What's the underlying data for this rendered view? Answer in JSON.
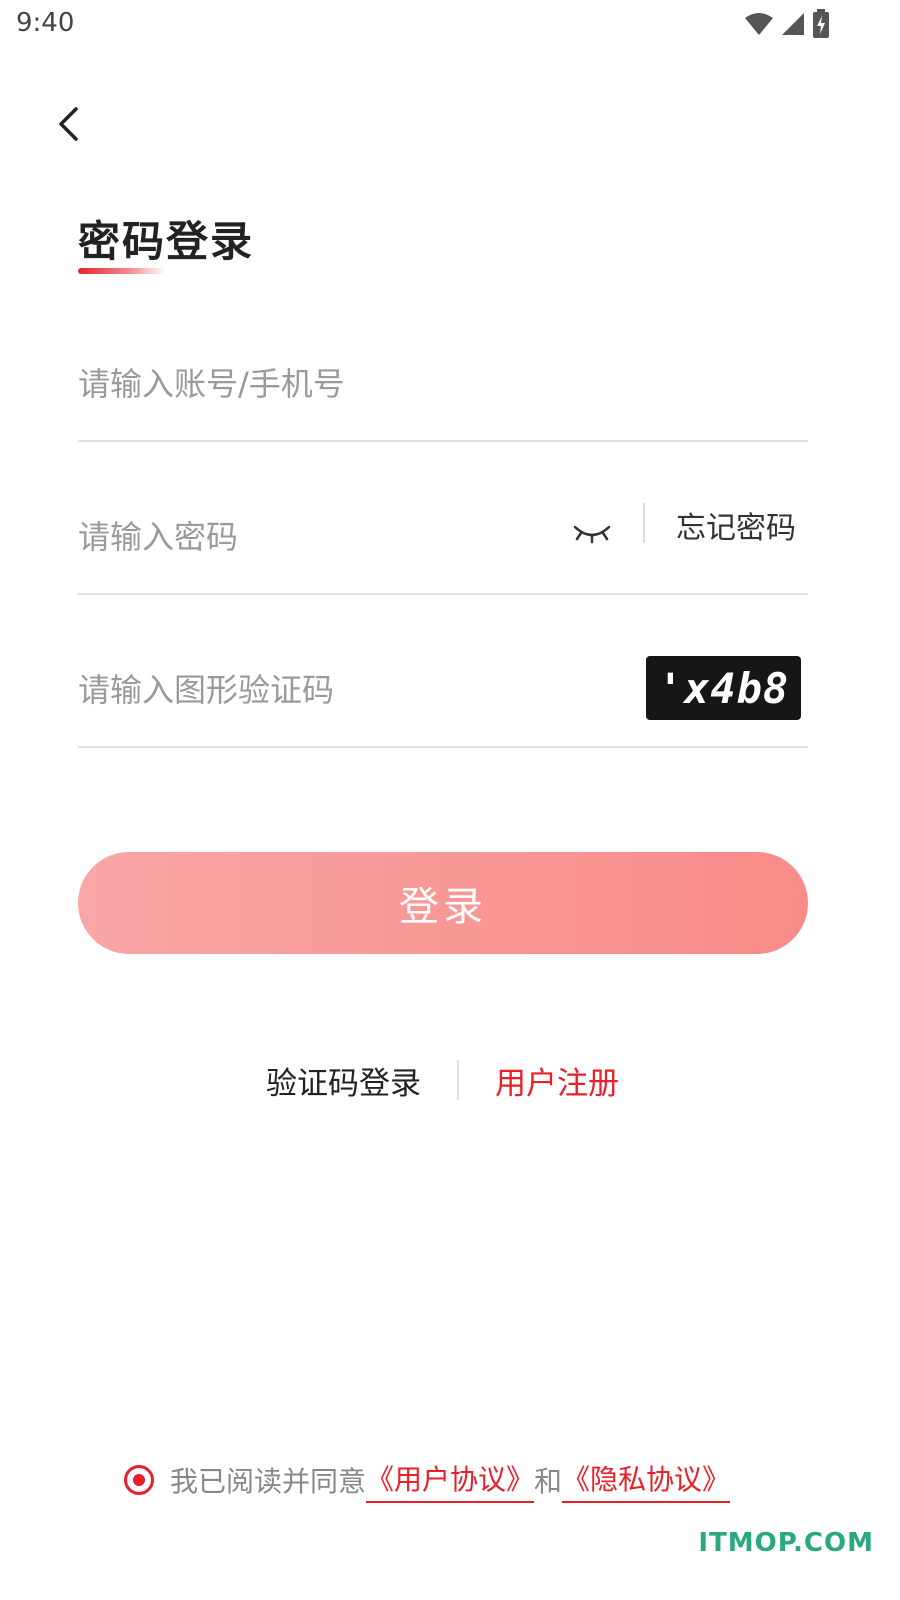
{
  "status_bar": {
    "time": "9:40"
  },
  "header": {
    "title": "密码登录"
  },
  "form": {
    "account_placeholder": "请输入账号/手机号",
    "password_placeholder": "请输入密码",
    "forgot_label": "忘记密码",
    "captcha_placeholder": "请输入图形验证码",
    "captcha_text": "'x4b8"
  },
  "login_button": "登录",
  "alt_links": {
    "sms_login": "验证码登录",
    "register": "用户注册"
  },
  "agreement": {
    "prefix": "我已阅读并同意",
    "user_agreement": "《用户协议》",
    "and": "和",
    "privacy_agreement": "《隐私协议》",
    "checked": true
  },
  "watermark": "ITMOP.COM",
  "colors": {
    "accent": "#e8202a",
    "button": "#f88b87",
    "watermark": "#2aa87e"
  }
}
